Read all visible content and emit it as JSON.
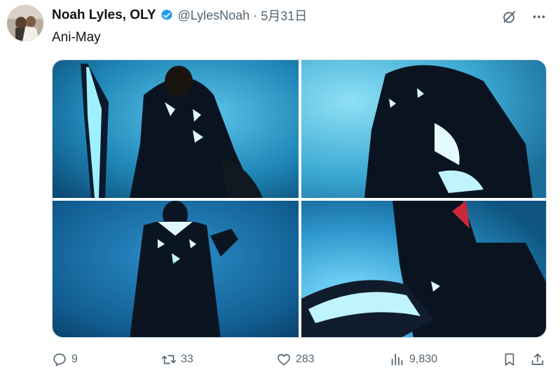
{
  "post": {
    "author_name": "Noah Lyles, OLY",
    "handle": "@LylesNoah",
    "separator": "·",
    "date": "5月31日",
    "text": "Ani-May"
  },
  "media": {
    "count": 4
  },
  "actions": {
    "replies": "9",
    "reposts": "33",
    "likes": "283",
    "views": "9,830"
  },
  "icons": {
    "verified": "verified-badge-icon",
    "grok": "grok-icon",
    "more": "more-icon",
    "reply": "reply-icon",
    "repost": "repost-icon",
    "like": "heart-icon",
    "views": "views-chart-icon",
    "bookmark": "bookmark-icon",
    "share": "share-icon"
  },
  "colors": {
    "verified_blue": "#1d9bf0",
    "muted": "#536471",
    "text": "#0f1419",
    "glow": "#8fe8ff"
  }
}
